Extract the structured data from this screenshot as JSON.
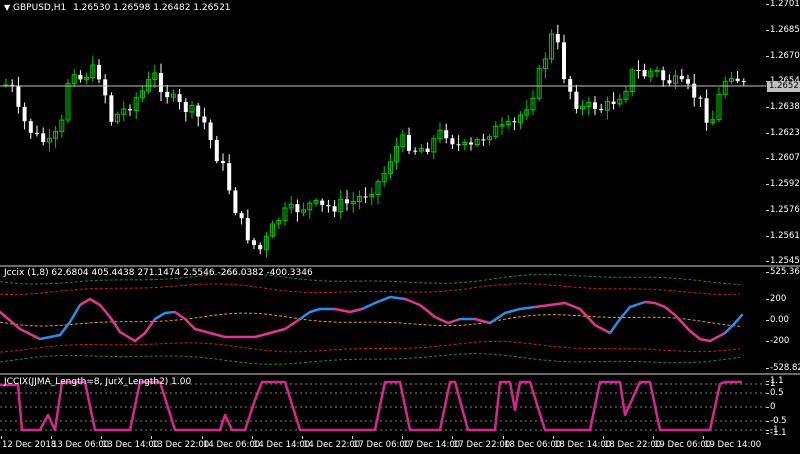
{
  "main_chart": {
    "symbol_title": "GBPUSD,H1",
    "ohlc": "1.26530 1.26598 1.26482 1.26521",
    "current_price": "1.26521",
    "axis_labels": [
      "1.27011",
      "1.26855",
      "1.26700",
      "1.26541",
      "1.26386",
      "1.26230",
      "1.26076",
      "1.25921",
      "1.25766",
      "1.25611",
      "1.25451"
    ],
    "colors": {
      "up_candle": "#00c800",
      "down_candle": "#ffffff",
      "price_line": "#c0c0c0",
      "background": "#000000"
    }
  },
  "indicator1": {
    "title": "Jccix (1,8) 62.6804 405.4438 271.1474 2.5546 -266.0382 -400.3346",
    "axis_labels": [
      "525.3632",
      "200",
      "0.00",
      "-200",
      "-528.8296"
    ],
    "colors": {
      "up": "#2a8de8",
      "down": "#e0368f",
      "level_upper": "#c81e1e",
      "level_outer": "#1e8c1e",
      "middle": "#e0a000"
    }
  },
  "indicator2": {
    "title": "JCCIX(JJMA_Length=8, JurX_Length2) 1.00",
    "axis_labels": [
      "1.1",
      "1",
      "0.5",
      "0",
      "-0.5",
      "-1",
      "-1.1"
    ],
    "colors": {
      "line": "#d4288f",
      "levels": "#808080"
    }
  },
  "time_axis": {
    "labels": [
      "12 Dec 2018",
      "13 Dec 06:00",
      "13 Dec 14:00",
      "13 Dec 22:00",
      "14 Dec 06:00",
      "14 Dec 14:00",
      "14 Dec 22:00",
      "17 Dec 06:00",
      "17 Dec 14:00",
      "17 Dec 22:00",
      "18 Dec 06:00",
      "18 Dec 14:00",
      "18 Dec 22:00",
      "19 Dec 06:00",
      "19 Dec 14:00"
    ]
  }
}
